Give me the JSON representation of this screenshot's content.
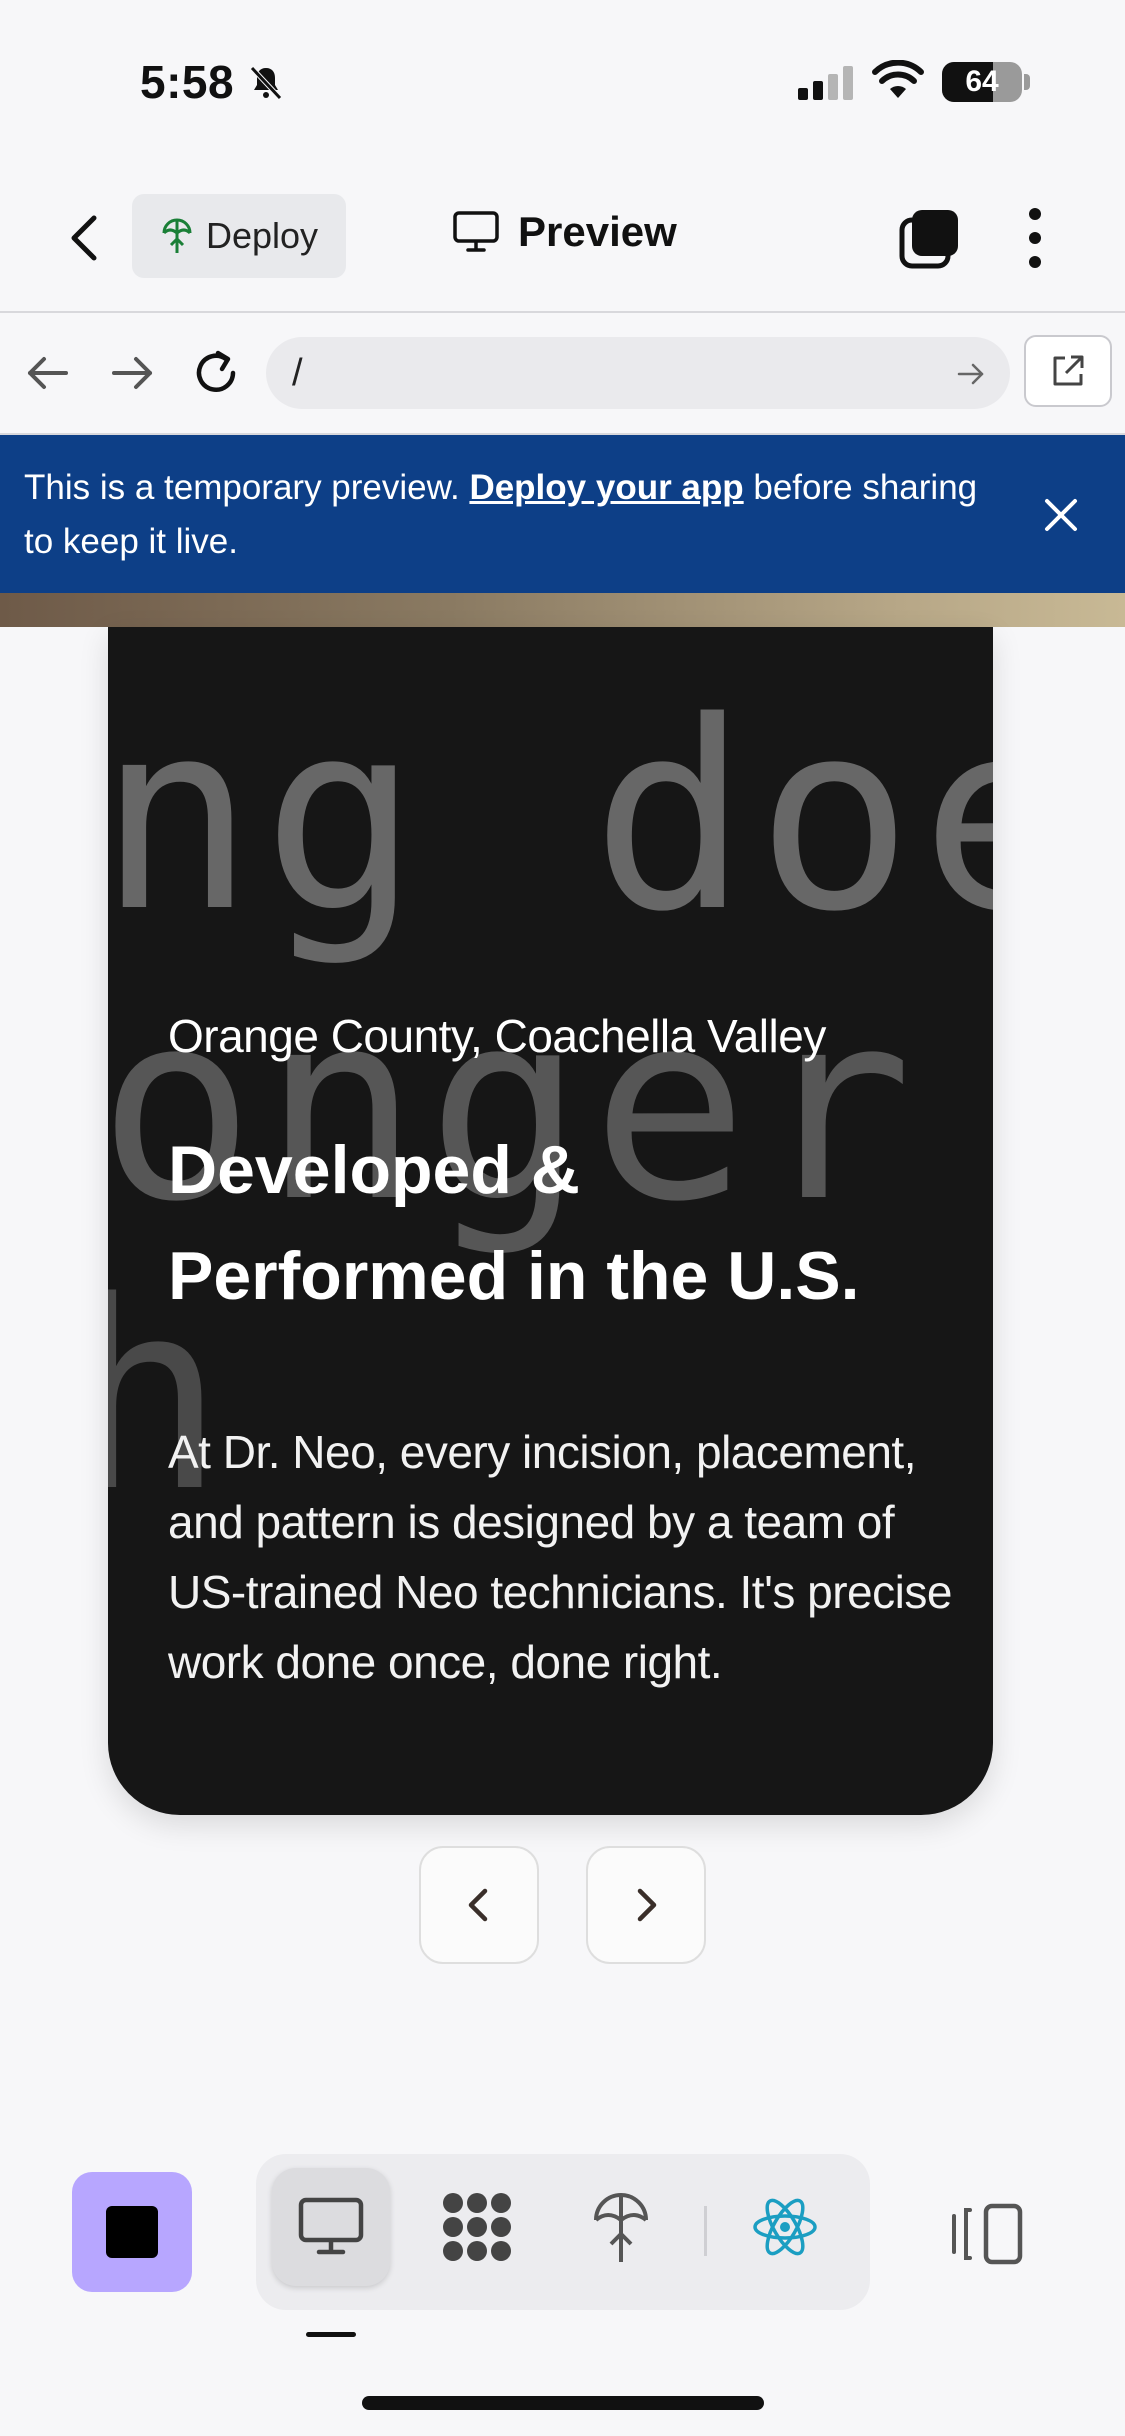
{
  "status": {
    "time": "5:58",
    "battery": "64",
    "battery_level": 0.64
  },
  "header": {
    "deploy_label": "Deploy",
    "title": "Preview"
  },
  "browser": {
    "url": "/"
  },
  "banner": {
    "text_before": "This is a temporary preview. ",
    "link": "Deploy your app",
    "text_after": " before sharing to keep it live."
  },
  "card": {
    "bg_words": [
      "ng does",
      "onger a"
    ],
    "location": "Orange County, Coachella Valley",
    "title": "Developed & Performed in the U.S.",
    "body": "At Dr. Neo, every incision, placement, and pattern is designed by a team of US-trained Neo technicians. It's precise work done once, done right."
  },
  "colors": {
    "banner": "#0d3f87",
    "card": "#161616",
    "stop_button": "#b7a6ff",
    "react_icon": "#1b9ec2"
  },
  "icons": [
    "bell-slash-icon",
    "signal-icon",
    "wifi-icon",
    "battery-icon",
    "back-chevron-icon",
    "deploy-icon",
    "monitor-icon",
    "tabs-icon",
    "more-vertical-icon",
    "arrow-left-icon",
    "arrow-right-icon",
    "reload-icon",
    "go-arrow-icon",
    "external-link-icon",
    "close-icon",
    "chevron-left-icon",
    "chevron-right-icon",
    "stop-icon",
    "desktop-icon",
    "grid-icon",
    "deploy-tree-icon",
    "react-icon",
    "panel-icon"
  ]
}
